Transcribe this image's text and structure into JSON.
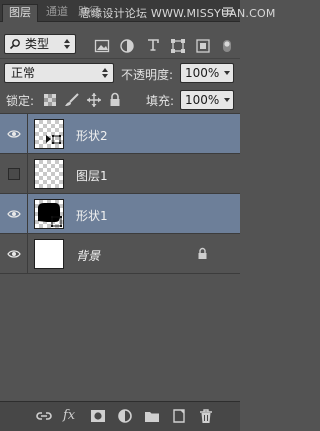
{
  "tabs": [
    "图层",
    "通道",
    "路径"
  ],
  "watermark": "思缘设计论坛 WWW.MISSYUAN.COM",
  "filter": {
    "label": "类型"
  },
  "blend_mode": {
    "value": "正常"
  },
  "opacity": {
    "label": "不透明度:",
    "value": "100%"
  },
  "lock": {
    "label": "锁定:"
  },
  "fill": {
    "label": "填充:",
    "value": "100%"
  },
  "layers": [
    {
      "name": "形状2",
      "visible": true,
      "selected": true,
      "thumb": "shape-small"
    },
    {
      "name": "图层1",
      "visible": false,
      "selected": false,
      "thumb": "transparent"
    },
    {
      "name": "形状1",
      "visible": true,
      "selected": true,
      "thumb": "shape-black"
    },
    {
      "name": "背景",
      "visible": true,
      "selected": false,
      "thumb": "white",
      "locked": true
    }
  ],
  "icons": {
    "bottom": [
      "link-layers-icon",
      "fx-icon",
      "add-mask-icon",
      "adjustment-layer-icon",
      "new-group-icon",
      "new-layer-icon",
      "delete-icon"
    ]
  },
  "colors": {
    "panel": "#535353",
    "selected": "#6d7f99",
    "tabbar": "#3a3a3a"
  }
}
